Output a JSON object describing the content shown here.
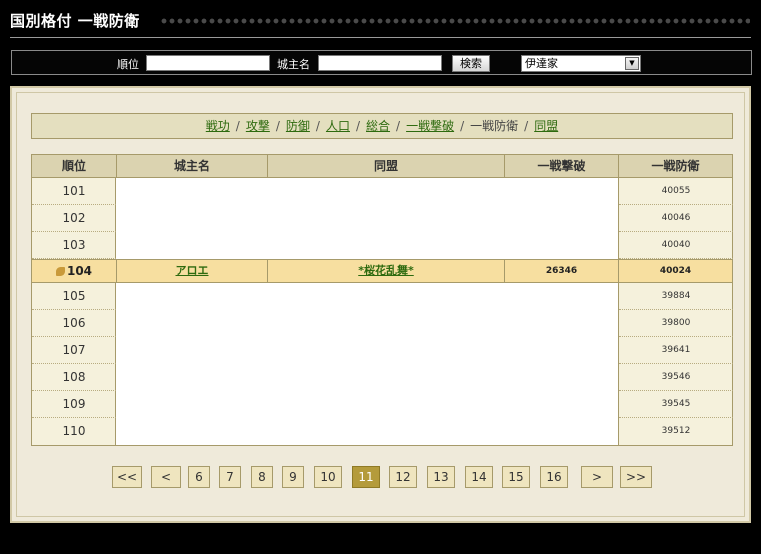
{
  "header": {
    "title": "国別格付 一戦防衛"
  },
  "search": {
    "rank_label": "順位",
    "rank_value": "",
    "lord_label": "城主名",
    "lord_value": "",
    "search_button": "検索",
    "country_selected": "伊達家"
  },
  "tabs": [
    {
      "label": "戦功",
      "current": false
    },
    {
      "label": "攻撃",
      "current": false
    },
    {
      "label": "防御",
      "current": false
    },
    {
      "label": "人口",
      "current": false
    },
    {
      "label": "総合",
      "current": false
    },
    {
      "label": "一戦撃破",
      "current": false
    },
    {
      "label": "一戦防衛",
      "current": true
    },
    {
      "label": "同盟",
      "current": false
    }
  ],
  "table": {
    "headers": [
      "順位",
      "城主名",
      "同盟",
      "一戦撃破",
      "一戦防衛"
    ],
    "rows": [
      {
        "rank": "101",
        "lord": "",
        "alliance": "",
        "attack": "",
        "defense": "40055"
      },
      {
        "rank": "102",
        "lord": "",
        "alliance": "",
        "attack": "",
        "defense": "40046"
      },
      {
        "rank": "103",
        "lord": "",
        "alliance": "",
        "attack": "",
        "defense": "40040"
      },
      {
        "rank": "104",
        "lord": "アロエ",
        "alliance": "*桜花乱舞*",
        "attack": "26346",
        "defense": "40024"
      },
      {
        "rank": "105",
        "lord": "",
        "alliance": "",
        "attack": "",
        "defense": "39884"
      },
      {
        "rank": "106",
        "lord": "",
        "alliance": "",
        "attack": "",
        "defense": "39800"
      },
      {
        "rank": "107",
        "lord": "",
        "alliance": "",
        "attack": "",
        "defense": "39641"
      },
      {
        "rank": "108",
        "lord": "",
        "alliance": "",
        "attack": "",
        "defense": "39546"
      },
      {
        "rank": "109",
        "lord": "",
        "alliance": "",
        "attack": "",
        "defense": "39545"
      },
      {
        "rank": "110",
        "lord": "",
        "alliance": "",
        "attack": "",
        "defense": "39512"
      }
    ]
  },
  "pagination": {
    "first": "<<",
    "prev": "<",
    "pages": [
      "6",
      "7",
      "8",
      "9",
      "10",
      "11",
      "12",
      "13",
      "14",
      "15",
      "16"
    ],
    "current": "11",
    "next": ">",
    "last": ">>"
  },
  "colors": {
    "background": "#000000",
    "panel": "#efeada",
    "link": "#2d6a0e",
    "highlight_row": "#f7dfa0",
    "active_page": "#b49b3b"
  }
}
